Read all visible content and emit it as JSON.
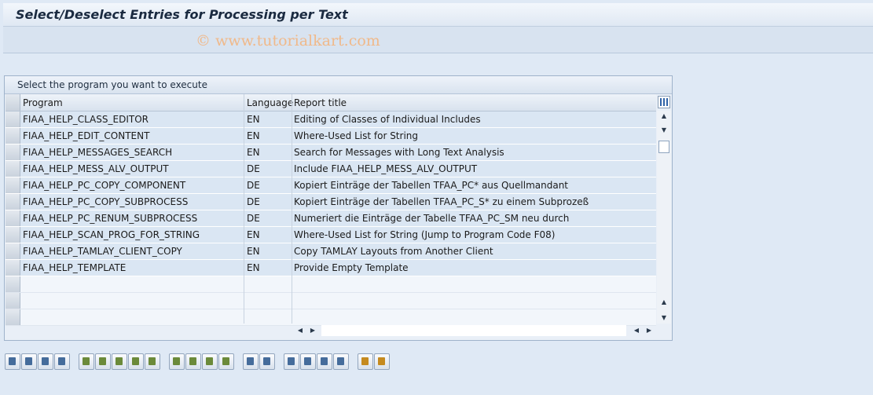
{
  "window": {
    "title": "Select/Deselect Entries for Processing per Text"
  },
  "watermark": "© www.tutorialkart.com",
  "panel": {
    "title": "Select the program you want to execute",
    "columns": {
      "program": "Program",
      "language": "Language",
      "report_title": "Report title"
    },
    "rows": [
      {
        "program": "FIAA_HELP_CLASS_EDITOR",
        "language": "EN",
        "title": "Editing of Classes of Individual Includes"
      },
      {
        "program": "FIAA_HELP_EDIT_CONTENT",
        "language": "EN",
        "title": "Where-Used List for String"
      },
      {
        "program": "FIAA_HELP_MESSAGES_SEARCH",
        "language": "EN",
        "title": "Search for Messages with Long Text Analysis"
      },
      {
        "program": "FIAA_HELP_MESS_ALV_OUTPUT",
        "language": "DE",
        "title": "Include FIAA_HELP_MESS_ALV_OUTPUT"
      },
      {
        "program": "FIAA_HELP_PC_COPY_COMPONENT",
        "language": "DE",
        "title": "Kopiert Einträge der Tabellen TFAA_PC* aus Quellmandant"
      },
      {
        "program": "FIAA_HELP_PC_COPY_SUBPROCESS",
        "language": "DE",
        "title": "Kopiert Einträge der Tabellen TFAA_PC_S* zu einem Subprozeß"
      },
      {
        "program": "FIAA_HELP_PC_RENUM_SUBPROCESS",
        "language": "DE",
        "title": "Numeriert die Einträge der Tabelle TFAA_PC_SM neu durch"
      },
      {
        "program": "FIAA_HELP_SCAN_PROG_FOR_STRING",
        "language": "EN",
        "title": "Where-Used List for String (Jump to Program Code F08)"
      },
      {
        "program": "FIAA_HELP_TAMLAY_CLIENT_COPY",
        "language": "EN",
        "title": "Copy TAMLAY Layouts from Another Client"
      },
      {
        "program": "FIAA_HELP_TEMPLATE",
        "language": "EN",
        "title": "Provide Empty Template"
      }
    ]
  },
  "toolbar": {
    "buttons": [
      "details-icon",
      "select-all-icon",
      "deselect-all-icon",
      "select-block-icon",
      "insert-row-icon",
      "append-row-icon",
      "delete-row-icon",
      "undo-icon",
      "copy-row-icon",
      "cut-icon",
      "copy-icon",
      "paste-icon",
      "paste-append-icon",
      "sort-ascending-icon",
      "sort-descending-icon",
      "find-icon",
      "find-next-icon",
      "totals-icon",
      "filter-icon",
      "export-icon",
      "print-icon"
    ]
  }
}
